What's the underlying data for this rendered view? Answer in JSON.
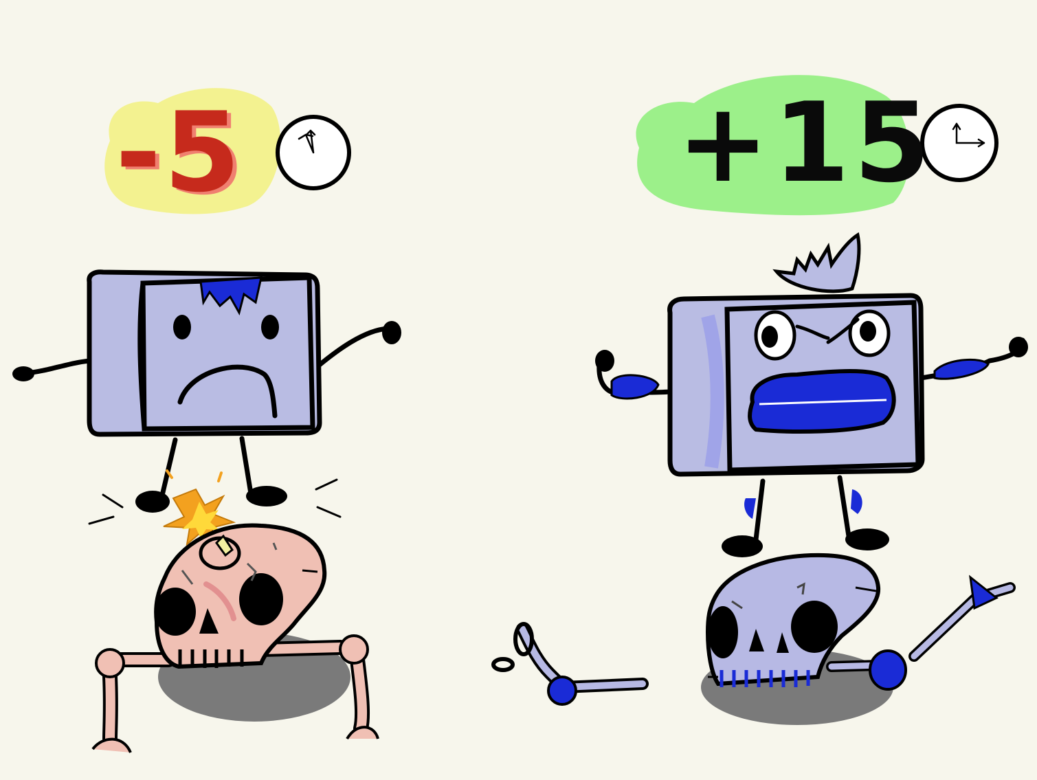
{
  "left_panel": {
    "score": "-5",
    "score_highlight_color": "#f3f290",
    "score_text_color": "#c62a1c",
    "icon": "clock-icon"
  },
  "right_panel": {
    "score": "+15",
    "score_highlight_color": "#9cf08a",
    "score_text_color": "#0a0a0a",
    "icon": "clock-icon"
  },
  "colors": {
    "background": "#f7f6ec",
    "robot_body": "#b9bce3",
    "robot_accent": "#1a2bd6",
    "skull_pink": "#f0c0b4",
    "skull_blue": "#b7b9e4",
    "shadow": "#7a7a7a"
  }
}
